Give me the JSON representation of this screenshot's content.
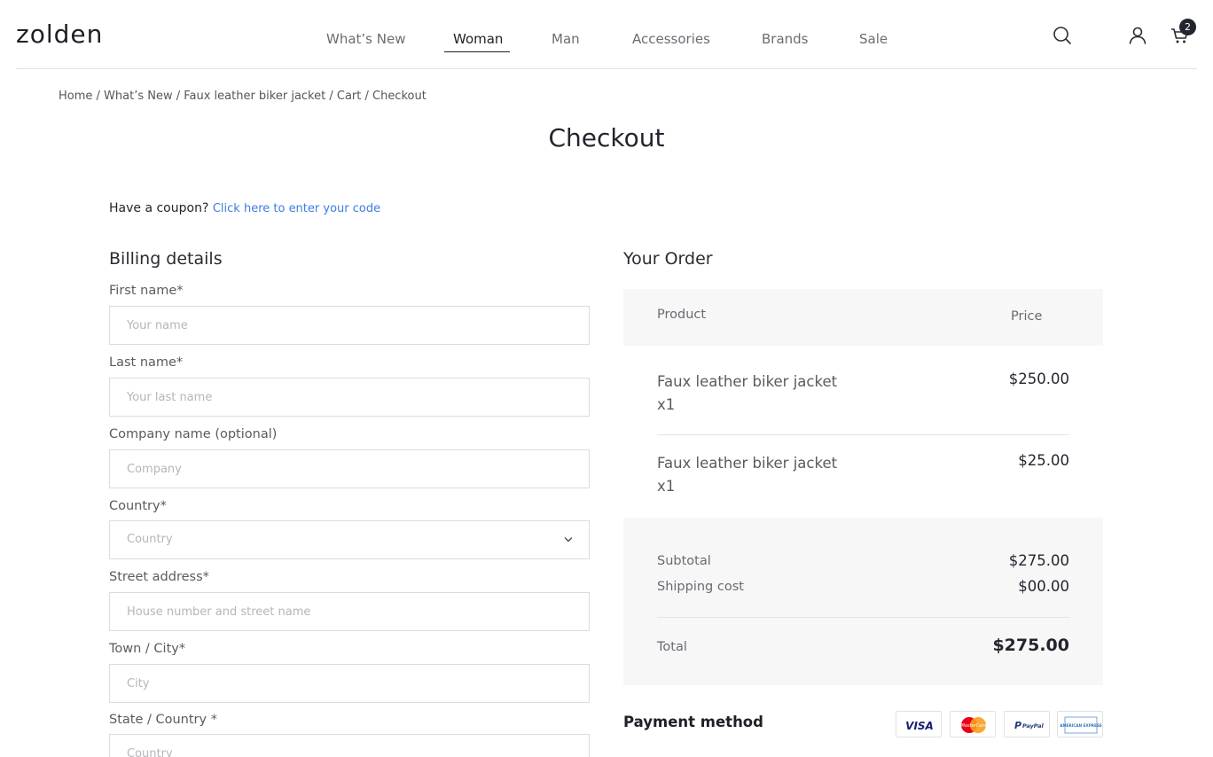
{
  "header": {
    "logo": "zolden",
    "nav": [
      "What’s New",
      "Woman",
      "Man",
      "Accessories",
      "Brands",
      "Sale"
    ],
    "active_nav": "Woman",
    "cart_count": "2"
  },
  "breadcrumb": "Home /  What’s New / Faux leather biker jacket / Cart / Checkout",
  "page_title": "Checkout",
  "coupon": {
    "text": "Have a coupon?",
    "link": "Click here to enter your code"
  },
  "billing": {
    "title": "Billing details",
    "fields": [
      {
        "label": "First name*",
        "placeholder": "Your name"
      },
      {
        "label": "Last name*",
        "placeholder": "Your last name"
      },
      {
        "label": "Company name (optional)",
        "placeholder": "Company"
      },
      {
        "label": "Country*",
        "placeholder": "Country"
      },
      {
        "label": "Street address*",
        "placeholder": "House number and street name"
      },
      {
        "label": "Town / City*",
        "placeholder": "City"
      },
      {
        "label": "State / Country *",
        "placeholder": "Country"
      }
    ]
  },
  "order": {
    "title": "Your Order",
    "col_product": "Product",
    "col_price": "Price",
    "items": [
      {
        "name": "Faux leather biker jacket",
        "qty": "x1",
        "price": "$250.00"
      },
      {
        "name": "Faux leather biker jacket",
        "qty": "x1",
        "price": "$25.00"
      }
    ],
    "subtotal_label": "Subtotal",
    "subtotal": "$275.00",
    "shipping_label": "Shipping cost",
    "shipping": "$00.00",
    "total_label": "Total",
    "total": "$275.00"
  },
  "payment": {
    "title": "Payment method",
    "cards": [
      "visa",
      "mastercard",
      "paypal",
      "american-express"
    ],
    "visa_text": "VISA",
    "mastercard_text": "MasterCard",
    "paypal_text": "PayPal",
    "amex_text": "AMERICAN EXPRESS"
  }
}
